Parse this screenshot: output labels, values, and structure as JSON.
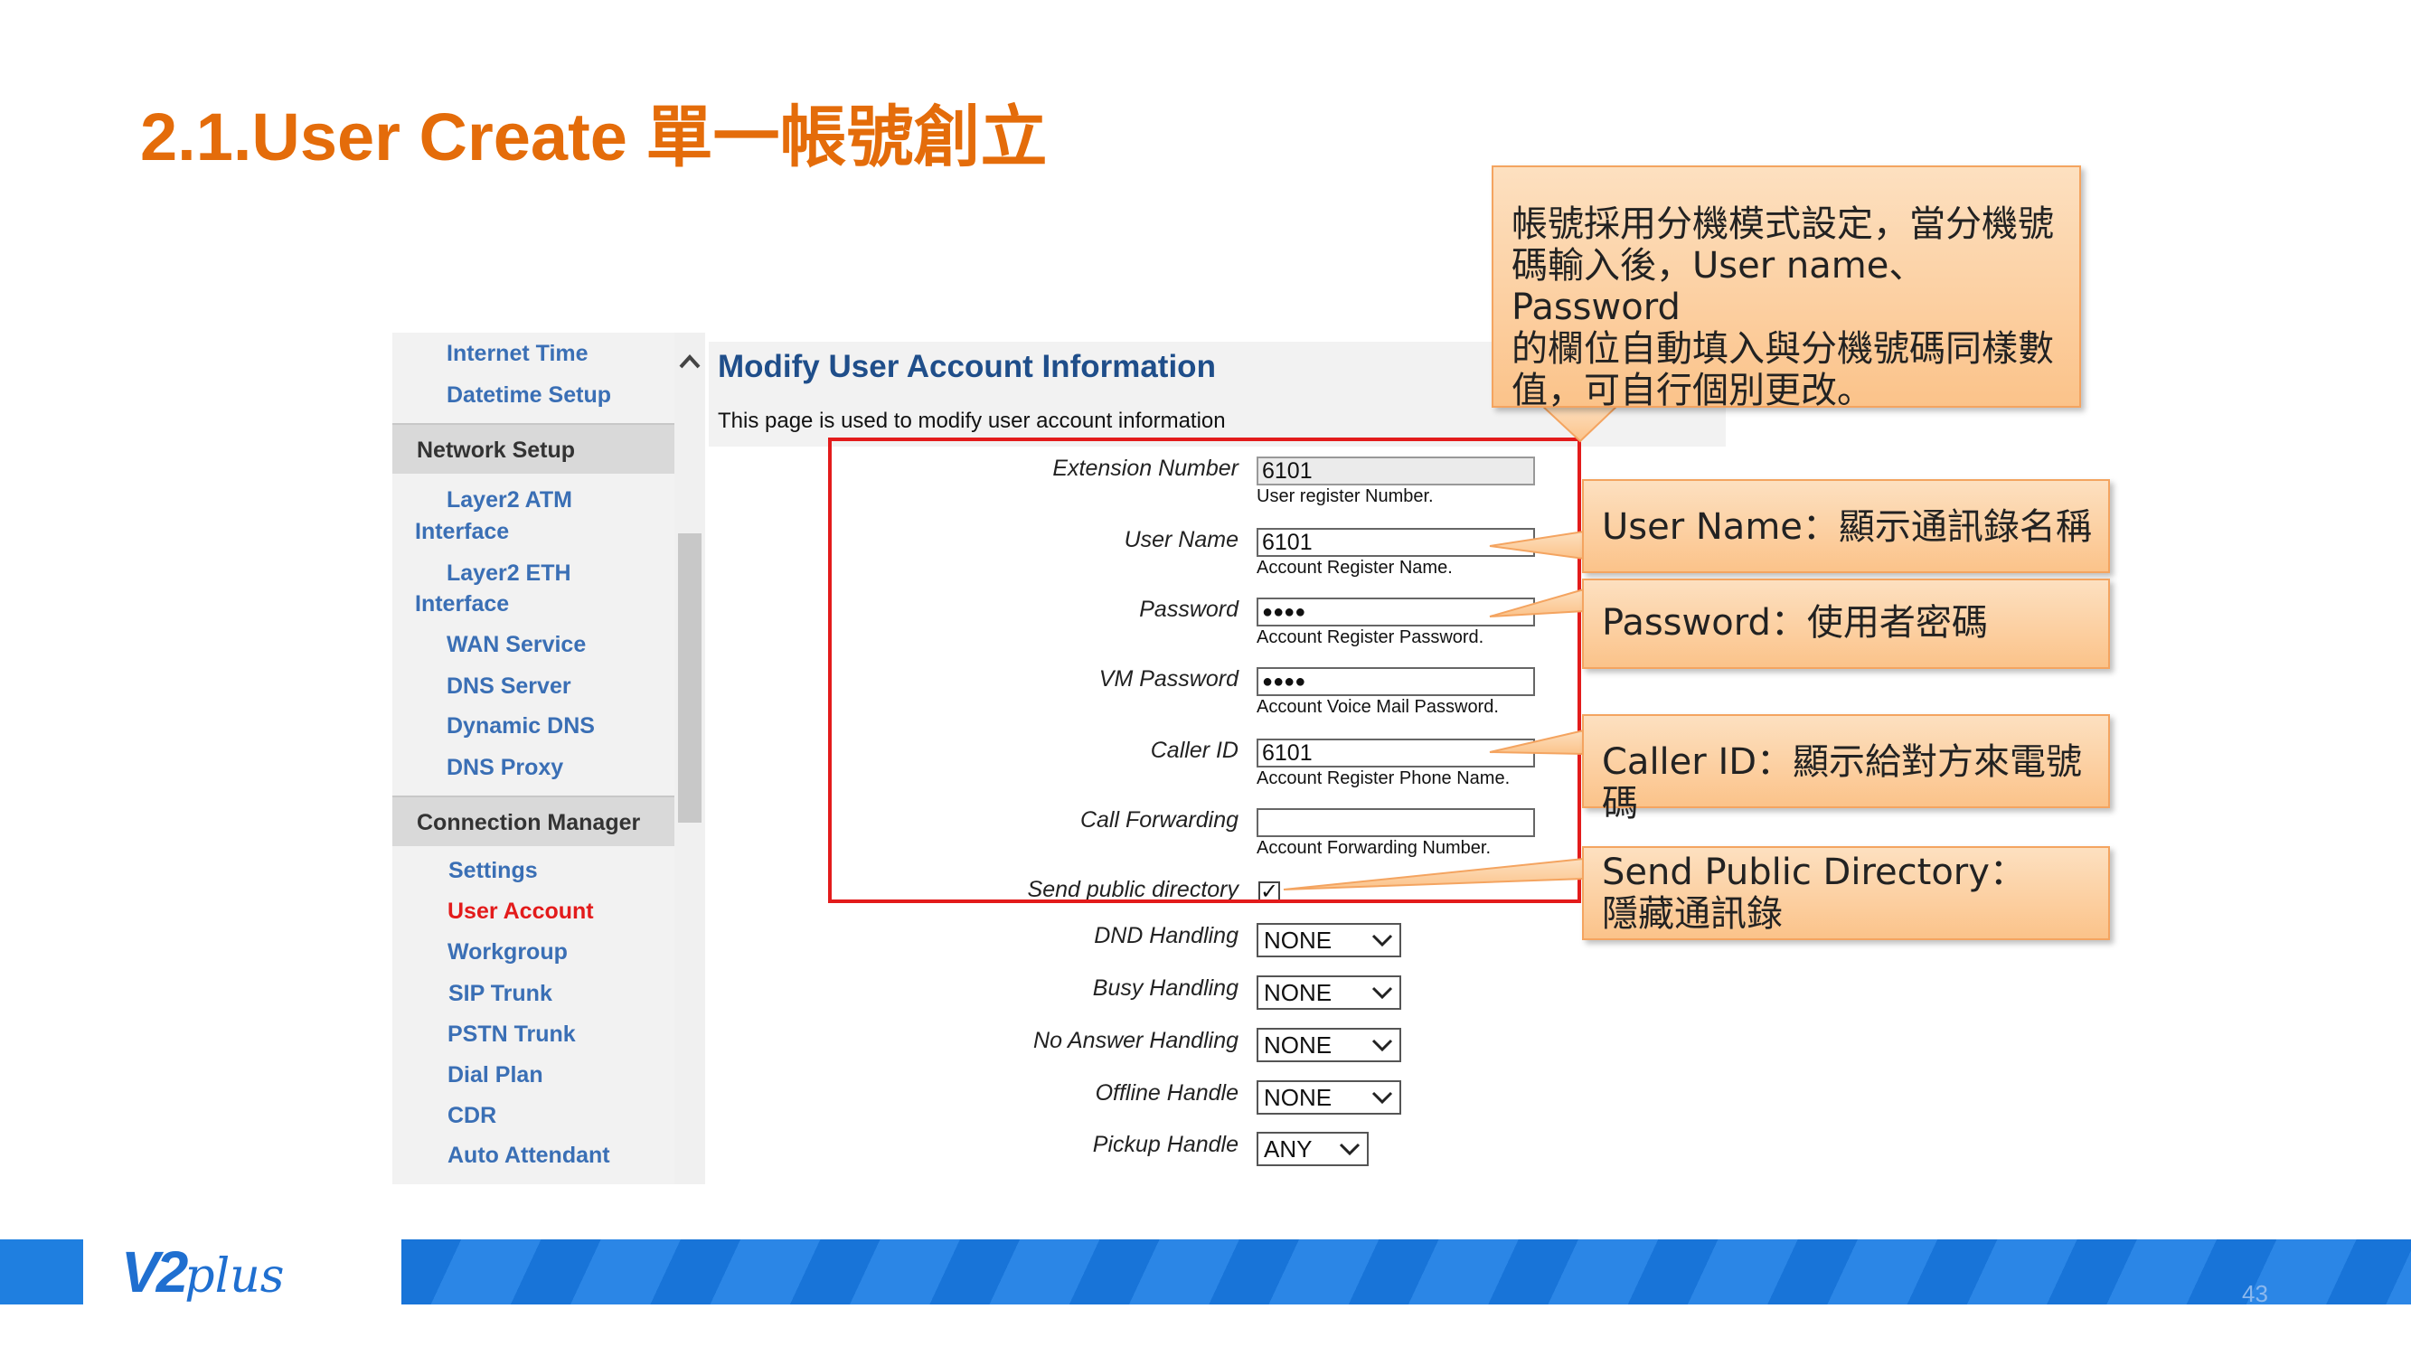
{
  "slide": {
    "title": "2.1.User Create 單一帳號創立",
    "page_number": "43"
  },
  "sidebar": {
    "links_top": [
      {
        "label": "Internet Time"
      },
      {
        "label": "Datetime Setup"
      }
    ],
    "section_network": "Network Setup",
    "network_items": [
      {
        "label_line1": "Layer2 ATM",
        "label_line2": "Interface"
      },
      {
        "label_line1": "Layer2 ETH",
        "label_line2": "Interface"
      },
      {
        "label": "WAN Service"
      },
      {
        "label": "DNS Server"
      },
      {
        "label": "Dynamic DNS"
      },
      {
        "label": "DNS Proxy"
      }
    ],
    "section_connection": "Connection Manager",
    "connection_items": [
      {
        "label": "Settings"
      },
      {
        "label": "User Account",
        "active": true
      },
      {
        "label": "Workgroup"
      },
      {
        "label": "SIP Trunk"
      },
      {
        "label": "PSTN Trunk"
      },
      {
        "label": "Dial Plan"
      },
      {
        "label": "CDR"
      },
      {
        "label": "Auto Attendant"
      }
    ]
  },
  "form": {
    "title": "Modify User Account Information",
    "description": "This page is used to modify user account information",
    "fields": {
      "extension": {
        "label": "Extension Number",
        "value": "6101",
        "hint": "User register Number."
      },
      "username": {
        "label": "User Name",
        "value": "6101",
        "hint": "Account Register Name."
      },
      "password": {
        "label": "Password",
        "value": "●●●●",
        "hint": "Account Register Password."
      },
      "vm_password": {
        "label": "VM Password",
        "value": "●●●●",
        "hint": "Account Voice Mail Password."
      },
      "caller_id": {
        "label": "Caller ID",
        "value": "6101",
        "hint": "Account Register Phone Name."
      },
      "call_forwarding": {
        "label": "Call Forwarding",
        "value": "",
        "hint": "Account Forwarding Number."
      },
      "send_public_directory": {
        "label": "Send public directory",
        "checked": true,
        "mark": "✓"
      },
      "dnd_handling": {
        "label": "DND Handling",
        "value": "NONE"
      },
      "busy_handling": {
        "label": "Busy Handling",
        "value": "NONE"
      },
      "no_answer_handling": {
        "label": "No Answer Handling",
        "value": "NONE"
      },
      "offline_handle": {
        "label": "Offline Handle",
        "value": "NONE"
      },
      "pickup_handle": {
        "label": "Pickup Handle",
        "value": "ANY"
      }
    }
  },
  "callouts": {
    "main": {
      "line1": "帳號採用分機模式設定，當分機號",
      "line2": "碼輸入後，User name、Password",
      "line3": "的欄位自動填入與分機號碼同樣數",
      "line4": "值，可自行個別更改。"
    },
    "username": "User Name：顯示通訊錄名稱",
    "password": "Password：使用者密碼",
    "caller_id": "Caller ID：顯示給對方來電號碼",
    "directory": {
      "line1": "Send Public Directory：",
      "line2": "隱藏通訊錄"
    }
  },
  "footer": {
    "logo_main": "V2",
    "logo_sub": "plus"
  },
  "colors": {
    "title": "#e46c0a",
    "sidebar_link": "#3a6fb5",
    "active_link": "#e31b1b",
    "highlight_box": "#e31b1b",
    "callout_fill": "#fbc38a",
    "footer_blue": "#1874d8"
  },
  "icons": {
    "scroll_up": "chevron-up-icon",
    "select_arrow": "chevron-down-icon",
    "checkbox": "checkmark-icon"
  }
}
